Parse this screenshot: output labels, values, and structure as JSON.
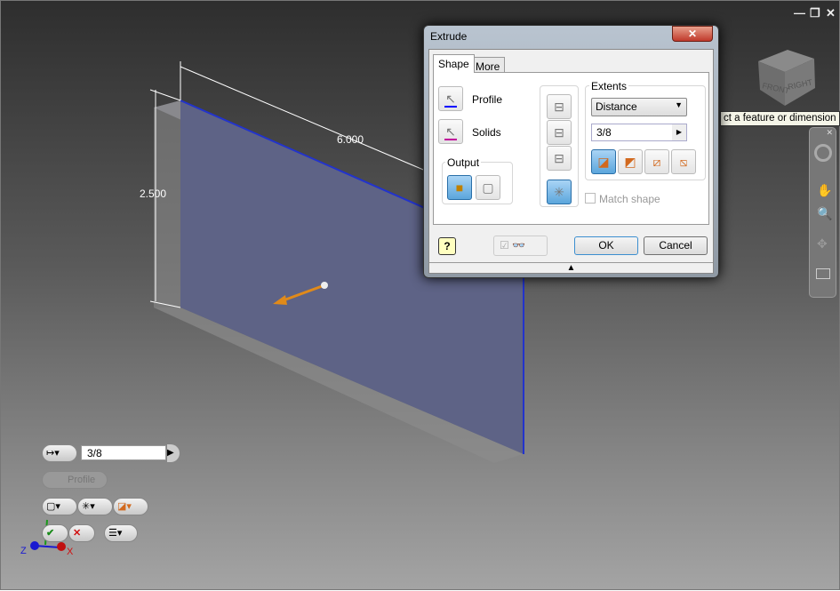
{
  "viewport": {
    "dimensions": {
      "length": "6.000",
      "height": "2.500"
    },
    "tooltip": "ct a feature or dimension",
    "viewcube": {
      "front": "FRONT",
      "right": "RIGHT"
    },
    "window_controls": {
      "minimize": "—",
      "restore": "❐",
      "close": "✕"
    },
    "axes": {
      "x": "X",
      "y": "Y",
      "z": "Z"
    }
  },
  "dialog": {
    "title": "Extrude",
    "close": "✕",
    "tabs": [
      {
        "label": "Shape"
      },
      {
        "label": "More"
      }
    ],
    "profile_label": "Profile",
    "solids_label": "Solids",
    "output_label": "Output",
    "extents_label": "Extents",
    "extents_type": "Distance",
    "distance_value": "3/8",
    "match_shape": "Match shape",
    "ok": "OK",
    "cancel": "Cancel",
    "help": "?"
  },
  "minitoolbar": {
    "distance_value": "3/8",
    "profile": "Profile"
  },
  "colors": {
    "accent": "#5ba6dc",
    "profile_line": "#0000ff",
    "solids_line": "#c0009a",
    "preview_arrow": "#e08a1a"
  }
}
